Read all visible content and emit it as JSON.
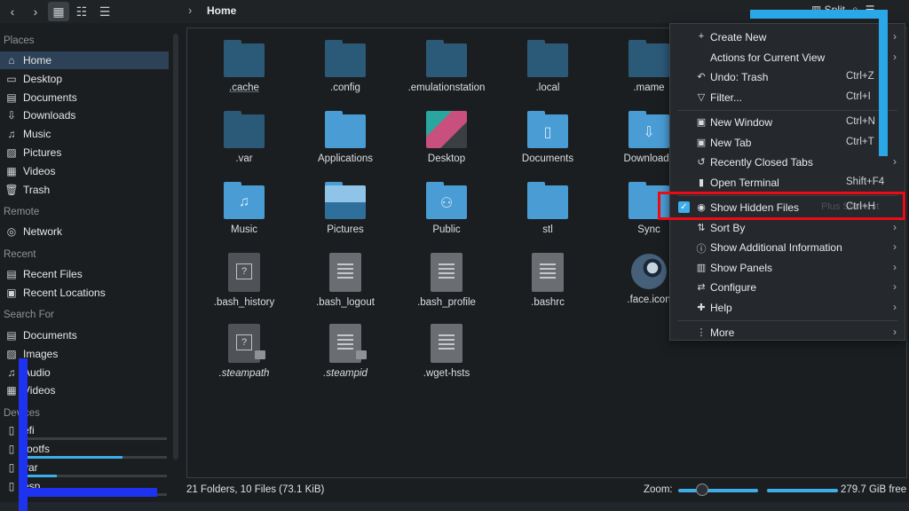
{
  "toolbar": {
    "breadcrumb": "Home",
    "split_label": "Split",
    "icons": [
      "back-icon",
      "forward-icon",
      "icon-view-icon",
      "compact-view-icon",
      "details-view-icon",
      "search-icon",
      "hamburger-menu-icon"
    ]
  },
  "sidebar": {
    "places_header": "Places",
    "places": [
      {
        "label": "Home",
        "icon": "home-icon",
        "selected": true
      },
      {
        "label": "Desktop",
        "icon": "desktop-icon"
      },
      {
        "label": "Documents",
        "icon": "documents-icon"
      },
      {
        "label": "Downloads",
        "icon": "downloads-icon"
      },
      {
        "label": "Music",
        "icon": "music-icon"
      },
      {
        "label": "Pictures",
        "icon": "pictures-icon"
      },
      {
        "label": "Videos",
        "icon": "videos-icon"
      },
      {
        "label": "Trash",
        "icon": "trash-icon"
      }
    ],
    "remote_header": "Remote",
    "remote": [
      {
        "label": "Network",
        "icon": "network-icon"
      }
    ],
    "recent_header": "Recent",
    "recent": [
      {
        "label": "Recent Files",
        "icon": "recent-files-icon"
      },
      {
        "label": "Recent Locations",
        "icon": "recent-locations-icon"
      }
    ],
    "search_header": "Search For",
    "search": [
      {
        "label": "Documents",
        "icon": "documents-icon"
      },
      {
        "label": "Images",
        "icon": "images-icon"
      },
      {
        "label": "Audio",
        "icon": "audio-icon"
      },
      {
        "label": "Videos",
        "icon": "videos-icon"
      }
    ],
    "devices_header": "Devices",
    "devices": [
      {
        "label": "efi",
        "usage": 0.02
      },
      {
        "label": "rootfs",
        "usage": 0.7
      },
      {
        "label": "var",
        "usage": 0.25
      },
      {
        "label": "esp",
        "usage": 0.1
      }
    ]
  },
  "files": [
    {
      "name": ".cache",
      "kind": "folder-hidden",
      "underline": true
    },
    {
      "name": ".config",
      "kind": "folder-hidden"
    },
    {
      "name": ".emulationstation",
      "kind": "folder-hidden"
    },
    {
      "name": ".local",
      "kind": "folder-hidden"
    },
    {
      "name": ".mame",
      "kind": "folder-hidden"
    },
    {
      "name": ".var",
      "kind": "folder-hidden"
    },
    {
      "name": "Applications",
      "kind": "folder"
    },
    {
      "name": "Desktop",
      "kind": "desktop"
    },
    {
      "name": "Documents",
      "kind": "folder",
      "glyph": "▯"
    },
    {
      "name": "Downloads",
      "kind": "folder",
      "glyph": "⇩"
    },
    {
      "name": "Music",
      "kind": "folder",
      "glyph": "♫"
    },
    {
      "name": "Pictures",
      "kind": "pictures"
    },
    {
      "name": "Public",
      "kind": "folder",
      "glyph": "⚇"
    },
    {
      "name": "stl",
      "kind": "folder"
    },
    {
      "name": "Sync",
      "kind": "folder"
    },
    {
      "name": ".bash_history",
      "kind": "unknown"
    },
    {
      "name": ".bash_logout",
      "kind": "text"
    },
    {
      "name": ".bash_profile",
      "kind": "text"
    },
    {
      "name": ".bashrc",
      "kind": "text"
    },
    {
      "name": ".face.icon",
      "kind": "steam"
    },
    {
      "name": ".steampath",
      "kind": "unknown-link",
      "italic": true
    },
    {
      "name": ".steampid",
      "kind": "text-link",
      "italic": true
    },
    {
      "name": ".wget-hsts",
      "kind": "text"
    }
  ],
  "status": {
    "summary": "21 Folders, 10 Files (73.1 KiB)",
    "zoom_label": "Zoom:",
    "free_space": "279.7 GiB free"
  },
  "menu": {
    "items": [
      {
        "label": "Create New",
        "icon": "+",
        "icon_name": "plus-icon",
        "submenu": true
      },
      {
        "label": "Actions for Current View",
        "submenu": true
      },
      {
        "label": "Undo: Trash",
        "icon": "↶",
        "icon_name": "undo-icon",
        "shortcut": "Ctrl+Z"
      },
      {
        "label": "Filter...",
        "icon": "▽",
        "icon_name": "filter-icon",
        "shortcut": "Ctrl+I"
      },
      {
        "sep": true
      },
      {
        "label": "New Window",
        "icon": "▣",
        "icon_name": "new-window-icon",
        "shortcut": "Ctrl+N"
      },
      {
        "label": "New Tab",
        "icon": "▣",
        "icon_name": "new-tab-icon",
        "shortcut": "Ctrl+T"
      },
      {
        "label": "Recently Closed Tabs",
        "icon": "↺",
        "icon_name": "history-icon",
        "submenu": true
      },
      {
        "label": "Open Terminal",
        "icon": "▮",
        "icon_name": "terminal-icon",
        "shortcut": "Shift+F4"
      },
      {
        "sep": true
      },
      {
        "label": "Show Hidden Files",
        "icon": "◉",
        "icon_name": "eye-icon",
        "shortcut": "Ctrl+H",
        "checked": true,
        "ghost": "Plus Shortcut"
      },
      {
        "label": "Sort By",
        "icon": "⇅",
        "icon_name": "sort-icon",
        "submenu": true
      },
      {
        "label": "Show Additional Information",
        "icon": "ⓘ",
        "icon_name": "info-icon",
        "submenu": true
      },
      {
        "label": "Show Panels",
        "icon": "▥",
        "icon_name": "panels-icon",
        "submenu": true
      },
      {
        "label": "Configure",
        "icon": "⇄",
        "icon_name": "configure-icon",
        "submenu": true
      },
      {
        "label": "Help",
        "icon": "✚",
        "icon_name": "help-icon",
        "submenu": true
      },
      {
        "sep": true
      },
      {
        "label": "More",
        "icon": "⋮",
        "icon_name": "more-icon",
        "submenu": true
      }
    ]
  },
  "colors": {
    "accent": "#3daee9",
    "annotation_red": "#ea0b16",
    "annotation_cyan": "#2aa7e6",
    "annotation_blue": "#1d33f0"
  }
}
